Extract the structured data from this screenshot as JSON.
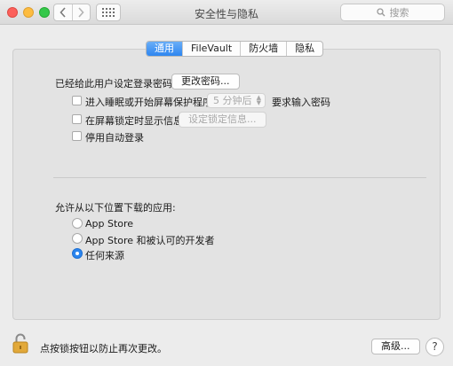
{
  "window": {
    "title": "安全性与隐私"
  },
  "search": {
    "placeholder": "搜索"
  },
  "tabs": [
    {
      "label": "通用",
      "active": true
    },
    {
      "label": "FileVault",
      "active": false
    },
    {
      "label": "防火墙",
      "active": false
    },
    {
      "label": "隐私",
      "active": false
    }
  ],
  "general": {
    "password_set_label": "已经给此用户设定登录密码",
    "change_password_button": "更改密码...",
    "require_password": {
      "label": "进入睡眠或开始屏幕保护程序",
      "delay_value": "5 分钟后",
      "suffix": "要求输入密码",
      "checked": false
    },
    "show_message": {
      "label": "在屏幕锁定时显示信息",
      "button": "设定锁定信息...",
      "checked": false
    },
    "disable_auto_login": {
      "label": "停用自动登录",
      "checked": false
    }
  },
  "downloads": {
    "heading": "允许从以下位置下载的应用:",
    "options": [
      {
        "label": "App Store",
        "selected": false
      },
      {
        "label": "App Store 和被认可的开发者",
        "selected": false
      },
      {
        "label": "任何来源",
        "selected": true
      }
    ]
  },
  "footer": {
    "lock_text": "点按锁按钮以防止再次更改。",
    "advanced_button": "高级...",
    "help_button": "?"
  },
  "colors": {
    "accent": "#2e86f0",
    "close": "#fc605b",
    "minimize": "#fdbc40",
    "zoom": "#34c84a"
  }
}
